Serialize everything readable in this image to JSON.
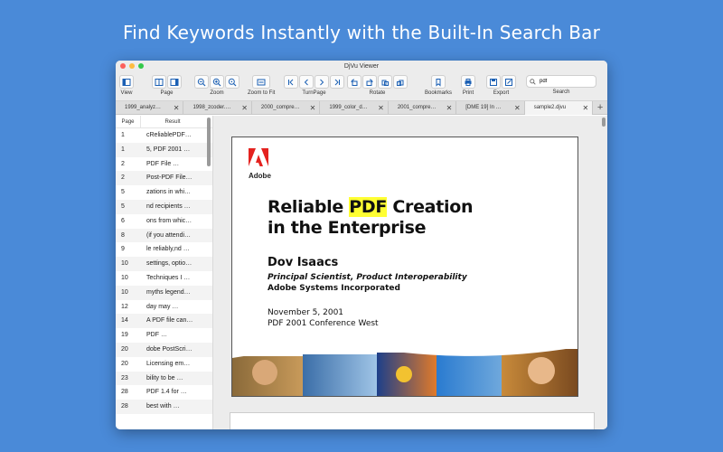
{
  "headline": "Find Keywords Instantly with the Built-In Search Bar",
  "window": {
    "title": "DjVu Viewer"
  },
  "toolbar": {
    "view_label": "View",
    "page_label": "Page",
    "zoom_label": "Zoom",
    "zoom_fit_label": "Zoom to Fit",
    "turnpage_label": "TurnPage",
    "rotate_label": "Rotate",
    "bookmarks_label": "Bookmarks",
    "print_label": "Print",
    "export_label": "Export",
    "search_label": "Search",
    "search_value": "pdf"
  },
  "tabs": [
    {
      "label": "1999_analyz…"
    },
    {
      "label": "1998_zcoder.…"
    },
    {
      "label": "2000_compre…"
    },
    {
      "label": "1999_color_d…"
    },
    {
      "label": "2001_compre…"
    },
    {
      "label": "[DME 19] In …"
    },
    {
      "label": "sample2.djvu"
    }
  ],
  "results": {
    "col_page": "Page",
    "col_result": "Result",
    "rows": [
      {
        "page": "1",
        "result": "cReliablePDF…"
      },
      {
        "page": "1",
        "result": "5, PDF 2001 …"
      },
      {
        "page": "2",
        "result": "PDF File …"
      },
      {
        "page": "2",
        "result": "Post-PDF File…"
      },
      {
        "page": "5",
        "result": "zations in whi…"
      },
      {
        "page": "5",
        "result": "nd recipients …"
      },
      {
        "page": "6",
        "result": "ons from whic…"
      },
      {
        "page": "8",
        "result": "(if you attendi…"
      },
      {
        "page": "9",
        "result": "le reliably,nd …"
      },
      {
        "page": "10",
        "result": "settings, optio…"
      },
      {
        "page": "10",
        "result": "Techniques I …"
      },
      {
        "page": "10",
        "result": "myths legend…"
      },
      {
        "page": "12",
        "result": "day may …"
      },
      {
        "page": "14",
        "result": "A PDF file can…"
      },
      {
        "page": "19",
        "result": "PDF …"
      },
      {
        "page": "20",
        "result": "dobe PostScri…"
      },
      {
        "page": "20",
        "result": "Licensing em…"
      },
      {
        "page": "23",
        "result": "bility to be …"
      },
      {
        "page": "28",
        "result": "PDF 1.4 for …"
      },
      {
        "page": "28",
        "result": "best with …"
      }
    ]
  },
  "document": {
    "logo_text": "Adobe",
    "title_pre": "Reliable ",
    "title_highlight": "PDF",
    "title_post": " Creation",
    "title_line2": "in the Enterprise",
    "author": "Dov Isaacs",
    "role": "Principal Scientist, Product Interoperability",
    "org": "Adobe Systems Incorporated",
    "date": "November 5, 2001",
    "conference": "PDF 2001 Conference West"
  },
  "colors": {
    "background": "#4a8ad8",
    "highlight": "#ffff33",
    "adobe_red": "#e4221f"
  }
}
